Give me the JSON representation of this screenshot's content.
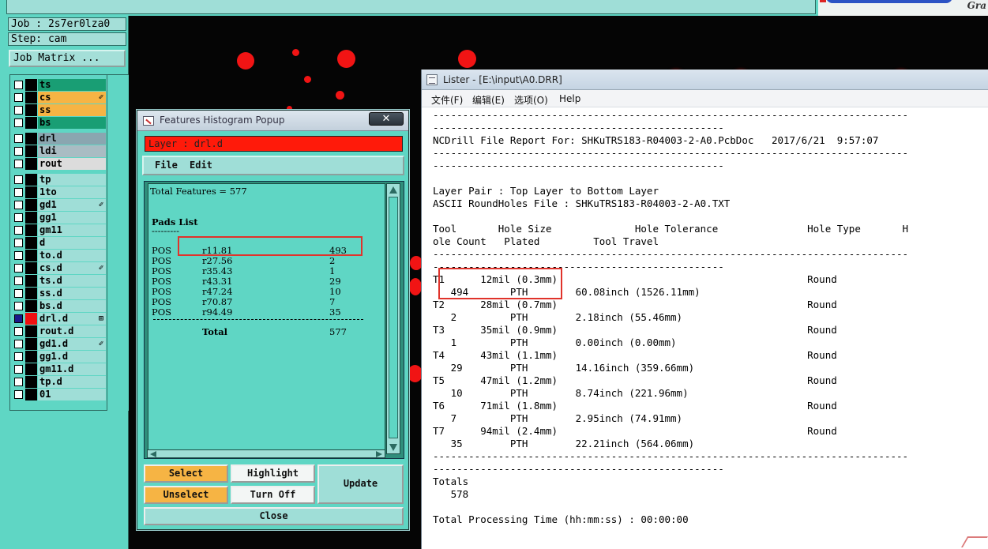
{
  "main_window": {
    "job": "Job : 2s7er0lza0",
    "step": "Step: cam",
    "job_matrix_button": "Job Matrix ...",
    "logo_tail": "Gra",
    "layers": [
      {
        "name": "ts",
        "mark": ""
      },
      {
        "name": "cs",
        "mark": "✐"
      },
      {
        "name": "ss",
        "mark": ""
      },
      {
        "name": "bs",
        "mark": ""
      },
      {
        "name": "drl",
        "mark": ""
      },
      {
        "name": "ldi",
        "mark": ""
      },
      {
        "name": "rout",
        "mark": ""
      },
      {
        "name": "tp",
        "mark": ""
      },
      {
        "name": "1to",
        "mark": ""
      },
      {
        "name": "gd1",
        "mark": "✐"
      },
      {
        "name": "gg1",
        "mark": ""
      },
      {
        "name": "gm11",
        "mark": ""
      },
      {
        "name": "d",
        "mark": ""
      },
      {
        "name": "to.d",
        "mark": ""
      },
      {
        "name": "cs.d",
        "mark": "✐"
      },
      {
        "name": "ts.d",
        "mark": ""
      },
      {
        "name": "ss.d",
        "mark": ""
      },
      {
        "name": "bs.d",
        "mark": ""
      },
      {
        "name": "drl.d",
        "mark": "⊞"
      },
      {
        "name": "rout.d",
        "mark": ""
      },
      {
        "name": "gd1.d",
        "mark": "✐"
      },
      {
        "name": "gg1.d",
        "mark": ""
      },
      {
        "name": "gm11.d",
        "mark": ""
      },
      {
        "name": "tp.d",
        "mark": ""
      },
      {
        "name": "01",
        "mark": ""
      }
    ]
  },
  "histogram": {
    "title": "Features Histogram Popup",
    "close_x": "✕",
    "layer_label": "Layer :  drl.d",
    "menu": {
      "file": "File",
      "edit": "Edit"
    },
    "total_features": "Total Features = 577",
    "pads_list_label": "Pads List",
    "pads_underline": "---------",
    "pads": [
      {
        "type": "POS",
        "symbol": "r11.81",
        "count": "493"
      },
      {
        "type": "POS",
        "symbol": "r27.56",
        "count": "2"
      },
      {
        "type": "POS",
        "symbol": "r35.43",
        "count": "1"
      },
      {
        "type": "POS",
        "symbol": "r43.31",
        "count": "29"
      },
      {
        "type": "POS",
        "symbol": "r47.24",
        "count": "10"
      },
      {
        "type": "POS",
        "symbol": "r70.87",
        "count": "7"
      },
      {
        "type": "POS",
        "symbol": "r94.49",
        "count": "35"
      }
    ],
    "total_label": "Total",
    "total_value": "577",
    "buttons": {
      "select": "Select",
      "highlight": "Highlight",
      "update": "Update",
      "unselect": "Unselect",
      "turn_off": "Turn Off",
      "close": "Close"
    }
  },
  "lister": {
    "title": "Lister - [E:\\input\\A0.DRR]",
    "menu": {
      "file": "文件(F)",
      "edit": "编辑(E)",
      "options": "选项(O)",
      "help": "Help"
    },
    "lines": [
      "--------------------------------------------------------------------------------",
      "-------------------------------------------------",
      "NCDrill File Report For: SHKuTRS183-R04003-2-A0.PcbDoc   2017/6/21  9:57:07",
      "--------------------------------------------------------------------------------",
      "-------------------------------------------------",
      "",
      "Layer Pair : Top Layer to Bottom Layer",
      "ASCII RoundHoles File : SHKuTRS183-R04003-2-A0.TXT",
      "",
      "Tool       Hole Size              Hole Tolerance               Hole Type       H",
      "ole Count   Plated         Tool Travel",
      "--------------------------------------------------------------------------------",
      "-------------------------------------------------",
      "T1      12mil (0.3mm)                                          Round",
      "   494       PTH        60.08inch (1526.11mm)",
      "T2      28mil (0.7mm)                                          Round",
      "   2         PTH        2.18inch (55.46mm)",
      "T3      35mil (0.9mm)                                          Round",
      "   1         PTH        0.00inch (0.00mm)",
      "T4      43mil (1.1mm)                                          Round",
      "   29        PTH        14.16inch (359.66mm)",
      "T5      47mil (1.2mm)                                          Round",
      "   10        PTH        8.74inch (221.96mm)",
      "T6      71mil (1.8mm)                                          Round",
      "   7         PTH        2.95inch (74.91mm)",
      "T7      94mil (2.4mm)                                          Round",
      "   35        PTH        22.21inch (564.06mm)",
      "--------------------------------------------------------------------------------",
      "-------------------------------------------------",
      "Totals",
      "   578",
      "",
      "Total Processing Time (hh:mm:ss) : 00:00:00"
    ]
  }
}
